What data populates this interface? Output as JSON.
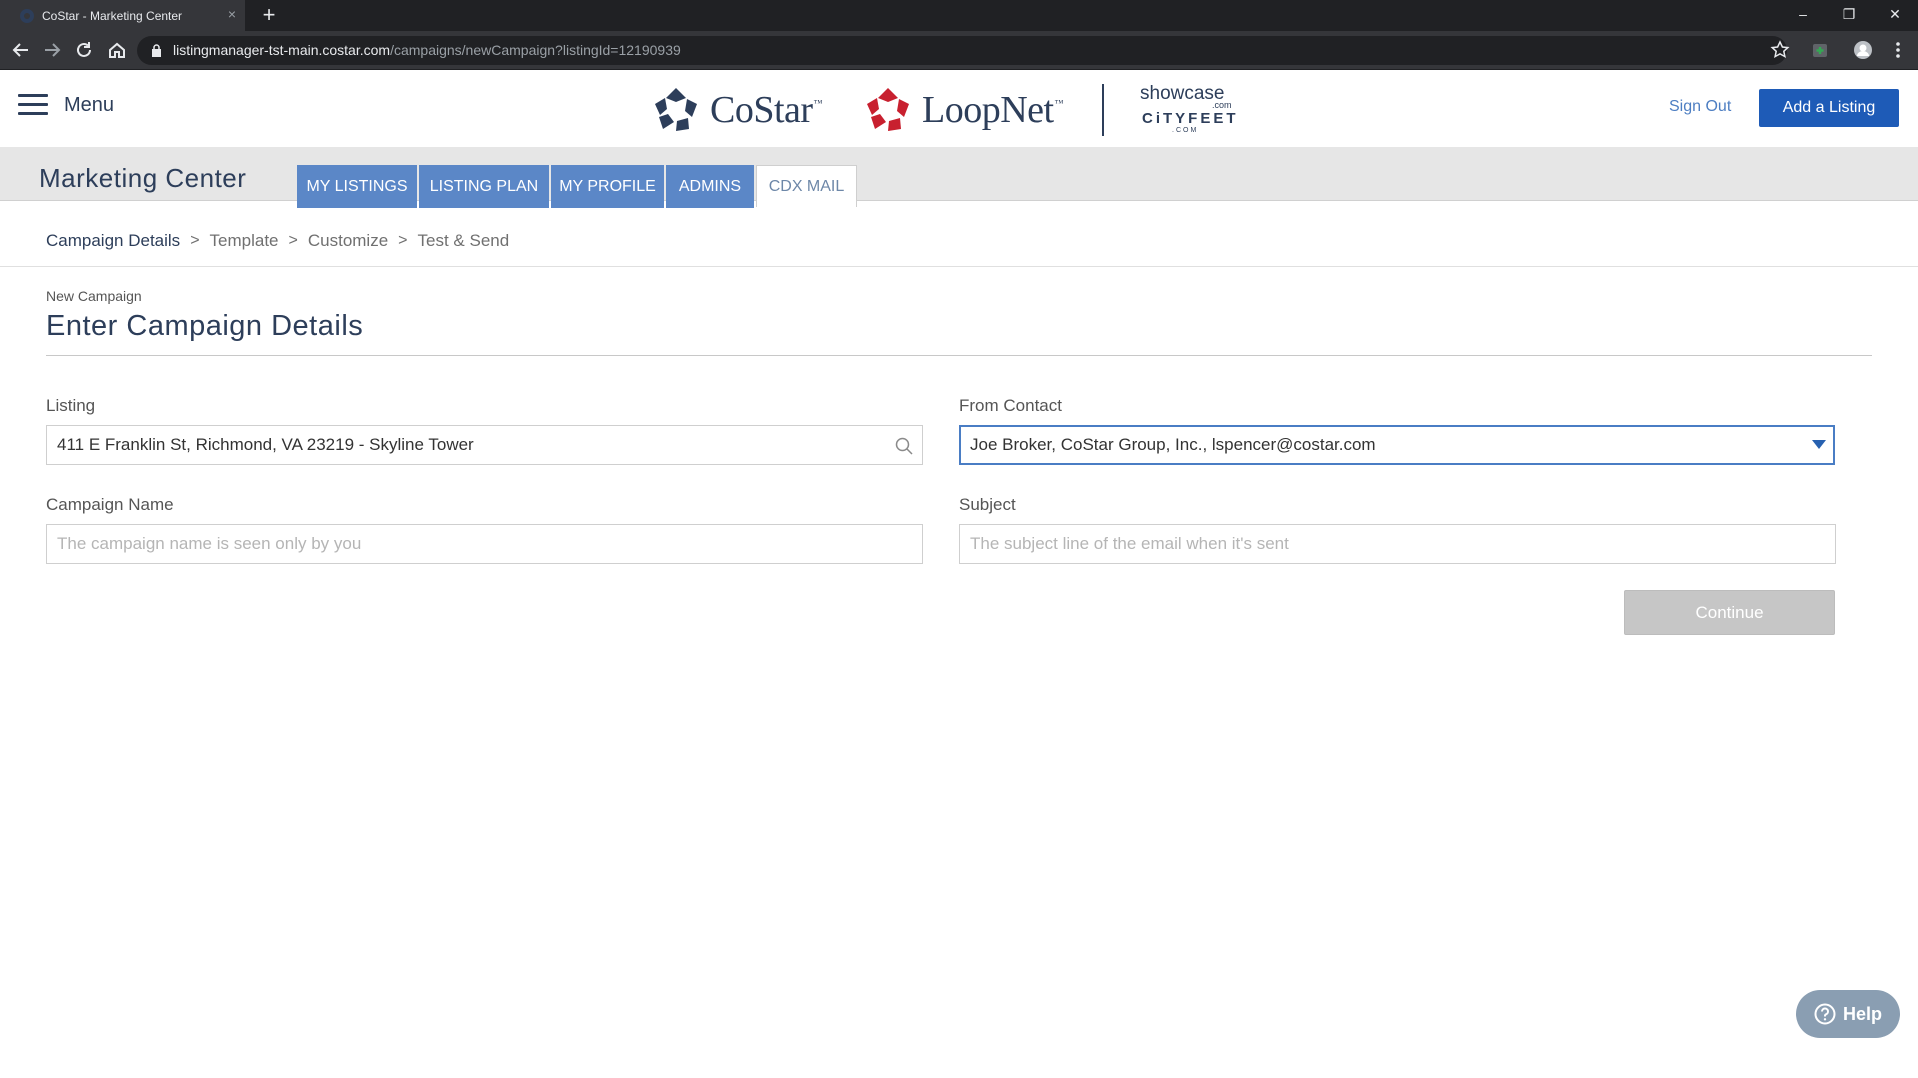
{
  "browser": {
    "tab_title": "CoStar - Marketing Center",
    "url_host": "listingmanager-tst-main.costar.com",
    "url_path": "/campaigns/newCampaign?listingId=12190939"
  },
  "header": {
    "menu_label": "Menu",
    "costar_word": "CoStar",
    "loopnet_word": "LoopNet",
    "trademark": "™",
    "showcase": "showcase",
    "showcase_com": ".com",
    "cityfeet": "CiTYFEET",
    "cityfeet_com": ".COM",
    "sign_out": "Sign Out",
    "add_listing": "Add a Listing"
  },
  "nav": {
    "title": "Marketing Center",
    "tabs": [
      {
        "label": "MY LISTINGS"
      },
      {
        "label": "LISTING PLAN"
      },
      {
        "label": "MY PROFILE"
      },
      {
        "label": "ADMINS"
      },
      {
        "label": "CDX MAIL"
      }
    ]
  },
  "breadcrumb": [
    "Campaign Details",
    "Template",
    "Customize",
    "Test & Send"
  ],
  "form": {
    "eyebrow": "New Campaign",
    "title": "Enter Campaign Details",
    "listing_label": "Listing",
    "listing_value": "411 E Franklin St,  Richmond,  VA 23219  - Skyline Tower",
    "from_label": "From Contact",
    "from_value": "Joe Broker, CoStar Group, Inc., lspencer@costar.com",
    "campaign_name_label": "Campaign Name",
    "campaign_name_placeholder": "The campaign name is seen only by you",
    "subject_label": "Subject",
    "subject_placeholder": "The subject line of the email when it's sent",
    "continue": "Continue"
  },
  "help_label": "Help",
  "colors": {
    "brand_navy": "#2d3e5a",
    "primary_blue": "#1e5bb7",
    "tab_blue": "#5b87c7",
    "loopnet_red": "#c8202f"
  }
}
